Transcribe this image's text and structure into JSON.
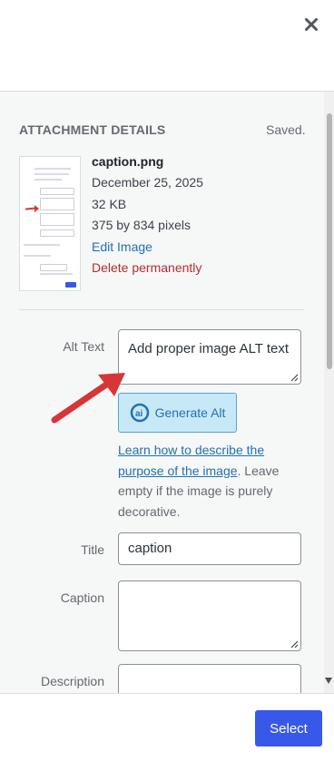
{
  "modal": {
    "close_icon": "close-icon"
  },
  "details": {
    "heading": "ATTACHMENT DETAILS",
    "status": "Saved.",
    "file_name": "caption.png",
    "date": "December 25, 2025",
    "size": "32 KB",
    "dimensions": "375 by 834 pixels",
    "edit_link": "Edit Image",
    "delete_link": "Delete permanently"
  },
  "fields": {
    "alt_text": {
      "label": "Alt Text",
      "value": "Add proper image ALT text"
    },
    "generate_alt": {
      "label": "Generate Alt",
      "icon": "ai-logo-icon"
    },
    "help": {
      "link_text": "Learn how to describe the purpose of the image",
      "rest_text": ". Leave empty if the image is purely decorative."
    },
    "title": {
      "label": "Title",
      "value": "caption"
    },
    "caption": {
      "label": "Caption",
      "value": ""
    },
    "description": {
      "label": "Description",
      "value": ""
    }
  },
  "footer": {
    "select_label": "Select"
  },
  "colors": {
    "accent": "#3858e9",
    "link": "#2271b1",
    "delete": "#b32d2e",
    "annotation_arrow": "#d63638",
    "generate_bg": "#c7e9f7"
  }
}
